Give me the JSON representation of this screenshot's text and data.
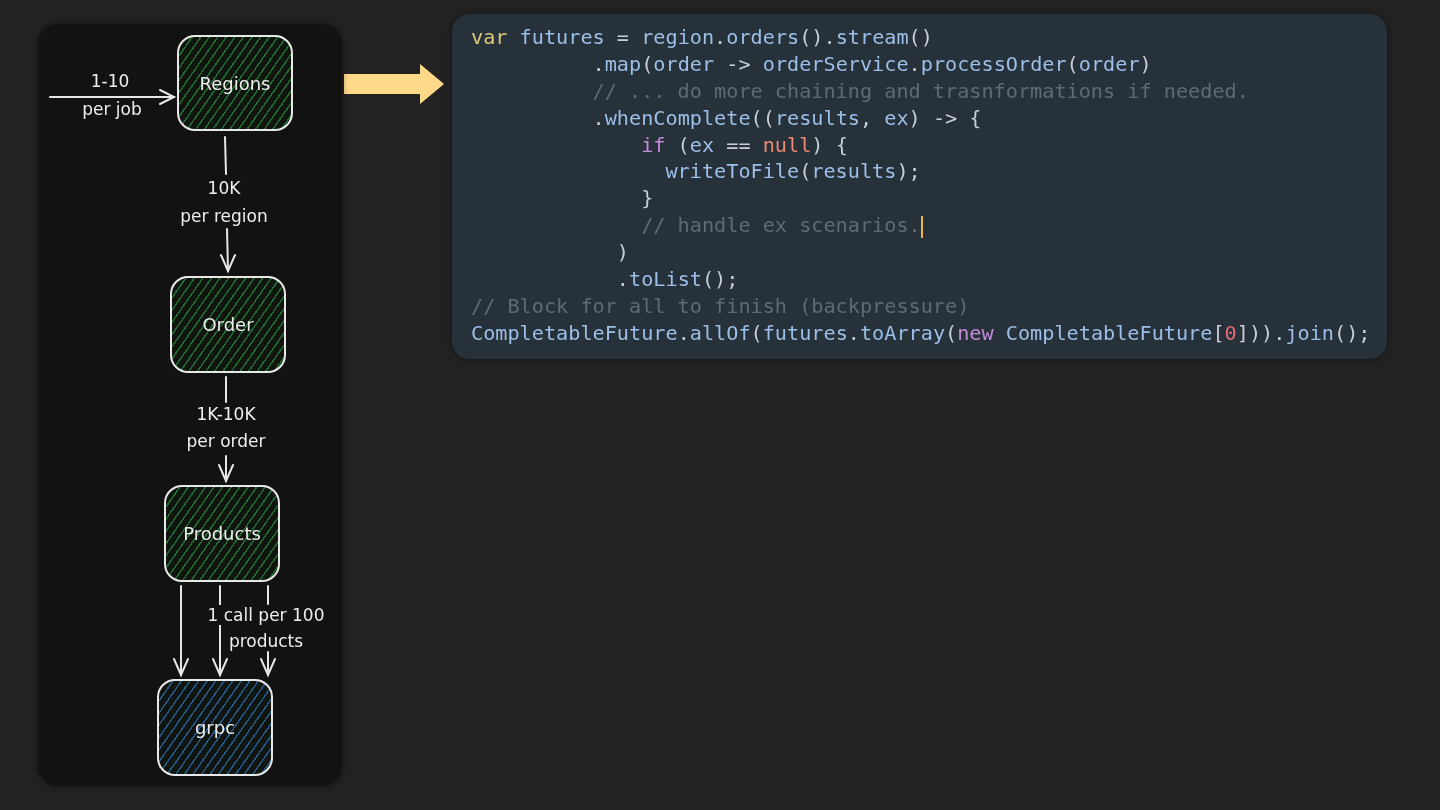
{
  "diagram": {
    "nodes": [
      {
        "label": "Regions",
        "color": "#1f6b30"
      },
      {
        "label": "Order",
        "color": "#1f6b30"
      },
      {
        "label": "Products",
        "color": "#1f6b30"
      },
      {
        "label": "grpc",
        "color": "#24578a"
      }
    ],
    "edge_labels": [
      "1-10",
      "per job",
      "10K",
      "per region",
      "1K-10K",
      "per order",
      "1 call per 100",
      "products"
    ]
  },
  "code": {
    "lines": [
      {
        "cursor": false,
        "tokens": [
          {
            "kind": "kw",
            "text": "var"
          },
          {
            "kind": "id",
            "text": " futures "
          },
          {
            "kind": "op",
            "text": "= "
          },
          {
            "kind": "id",
            "text": "region"
          },
          {
            "kind": "op",
            "text": "."
          },
          {
            "kind": "id",
            "text": "orders"
          },
          {
            "kind": "op",
            "text": "()."
          },
          {
            "kind": "id",
            "text": "stream"
          },
          {
            "kind": "op",
            "text": "()"
          }
        ]
      },
      {
        "cursor": false,
        "tokens": [
          {
            "kind": "op",
            "text": "          ."
          },
          {
            "kind": "id",
            "text": "map"
          },
          {
            "kind": "op",
            "text": "("
          },
          {
            "kind": "id",
            "text": "order"
          },
          {
            "kind": "op",
            "text": " -> "
          },
          {
            "kind": "id",
            "text": "orderService"
          },
          {
            "kind": "op",
            "text": "."
          },
          {
            "kind": "id",
            "text": "processOrder"
          },
          {
            "kind": "op",
            "text": "("
          },
          {
            "kind": "id",
            "text": "order"
          },
          {
            "kind": "op",
            "text": ")"
          }
        ]
      },
      {
        "cursor": false,
        "tokens": [
          {
            "kind": "comment",
            "text": "          // ... do more chaining and trasnformations if needed."
          }
        ]
      },
      {
        "cursor": false,
        "tokens": [
          {
            "kind": "op",
            "text": "          ."
          },
          {
            "kind": "id",
            "text": "whenComplete"
          },
          {
            "kind": "op",
            "text": "(("
          },
          {
            "kind": "id",
            "text": "results"
          },
          {
            "kind": "op",
            "text": ", "
          },
          {
            "kind": "id",
            "text": "ex"
          },
          {
            "kind": "op",
            "text": ") -> {"
          }
        ]
      },
      {
        "cursor": false,
        "tokens": [
          {
            "kind": "ctl",
            "text": "              if"
          },
          {
            "kind": "op",
            "text": " ("
          },
          {
            "kind": "id",
            "text": "ex"
          },
          {
            "kind": "op",
            "text": " == "
          },
          {
            "kind": "lit",
            "text": "null"
          },
          {
            "kind": "op",
            "text": ") {"
          }
        ]
      },
      {
        "cursor": false,
        "tokens": [
          {
            "kind": "id",
            "text": "                writeToFile"
          },
          {
            "kind": "op",
            "text": "("
          },
          {
            "kind": "id",
            "text": "results"
          },
          {
            "kind": "op",
            "text": ");"
          }
        ]
      },
      {
        "cursor": false,
        "tokens": [
          {
            "kind": "op",
            "text": "              }"
          }
        ]
      },
      {
        "cursor": true,
        "tokens": [
          {
            "kind": "comment",
            "text": "              // handle ex scenarios."
          }
        ]
      },
      {
        "cursor": false,
        "tokens": [
          {
            "kind": "op",
            "text": "            )"
          }
        ]
      },
      {
        "cursor": false,
        "tokens": [
          {
            "kind": "op",
            "text": "            ."
          },
          {
            "kind": "id",
            "text": "toList"
          },
          {
            "kind": "op",
            "text": "();"
          }
        ]
      },
      {
        "cursor": false,
        "tokens": [
          {
            "kind": "comment",
            "text": "// Block for all to finish (backpressure)"
          }
        ]
      },
      {
        "cursor": false,
        "tokens": [
          {
            "kind": "id",
            "text": "CompletableFuture"
          },
          {
            "kind": "op",
            "text": "."
          },
          {
            "kind": "id",
            "text": "allOf"
          },
          {
            "kind": "op",
            "text": "("
          },
          {
            "kind": "id",
            "text": "futures"
          },
          {
            "kind": "op",
            "text": "."
          },
          {
            "kind": "id",
            "text": "toArray"
          },
          {
            "kind": "op",
            "text": "("
          },
          {
            "kind": "ctl",
            "text": "new"
          },
          {
            "kind": "id",
            "text": " CompletableFuture"
          },
          {
            "kind": "op",
            "text": "["
          },
          {
            "kind": "num",
            "text": "0"
          },
          {
            "kind": "op",
            "text": "]))."
          },
          {
            "kind": "id",
            "text": "join"
          },
          {
            "kind": "op",
            "text": "();"
          }
        ]
      }
    ]
  }
}
